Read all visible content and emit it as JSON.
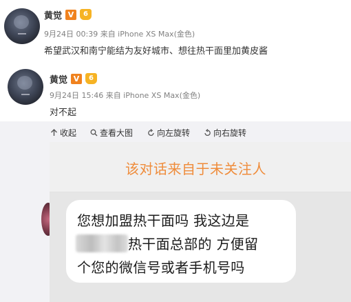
{
  "posts": [
    {
      "author": "黄觉",
      "verified_badge": "V",
      "level_badge": "6",
      "meta": "9月24日 00:39 来自 iPhone XS Max(金色)",
      "text": "希望武汉和南宁能结为友好城市、想往热干面里加黄皮酱"
    },
    {
      "author": "黄觉",
      "verified_badge": "V",
      "level_badge": "6",
      "meta": "9月24日 15:46 来自 iPhone XS Max(金色)",
      "text": "对不起"
    }
  ],
  "toolbar": {
    "collapse": "收起",
    "view_large": "查看大图",
    "rotate_left": "向左旋转",
    "rotate_right": "向右旋转"
  },
  "photo": {
    "notice": "该对话来自于未关注人",
    "bubble_line_1": "您想加盟热干面吗 我这边是",
    "bubble_line_2": "热干面总部的 方便留",
    "bubble_line_3": "个您的微信号或者手机号吗"
  },
  "colors": {
    "verified_badge": "#f0821e",
    "level_badge": "#f6b324",
    "notice_text": "#ef8c3b",
    "toolbar_bg": "#f2f2f5"
  }
}
